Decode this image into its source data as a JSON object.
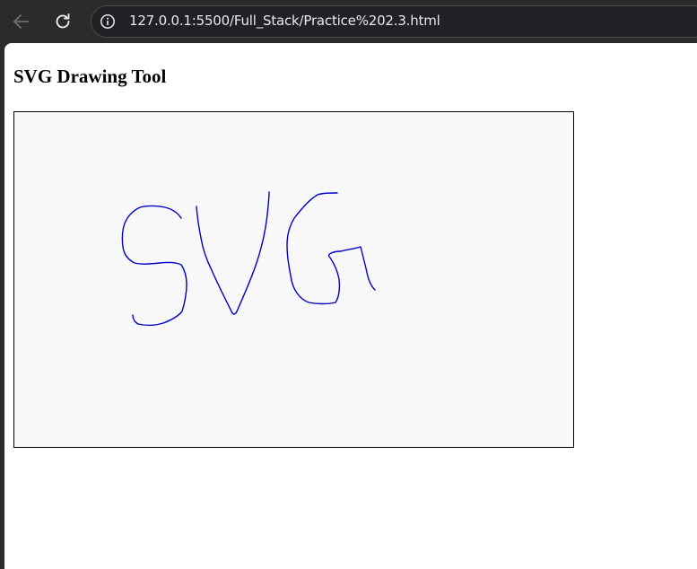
{
  "browser": {
    "url": "127.0.0.1:5500/Full_Stack/Practice%202.3.html",
    "back_icon": "arrow-left-icon",
    "reload_icon": "reload-icon",
    "site_info_icon": "info-icon"
  },
  "page": {
    "heading": "SVG Drawing Tool"
  },
  "drawing": {
    "stroke_color": "#0000cc",
    "background_color": "#f8f8f8",
    "border_color": "#000000"
  }
}
